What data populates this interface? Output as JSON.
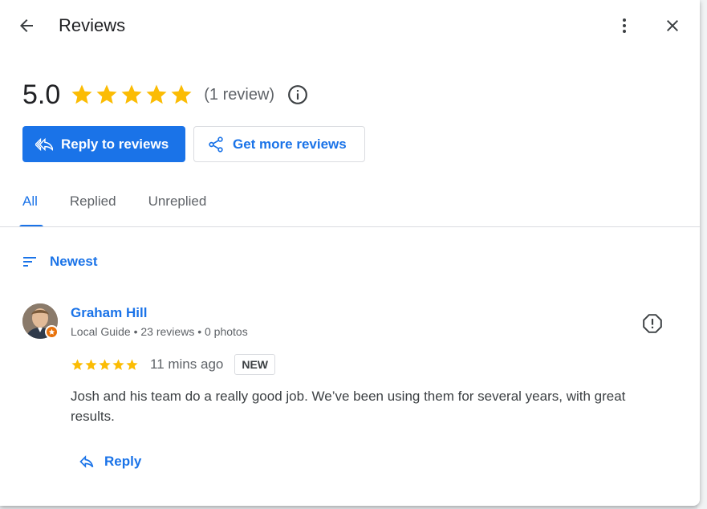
{
  "header": {
    "title": "Reviews",
    "back_icon": "arrow-back-icon",
    "more_icon": "more-vert-icon",
    "close_icon": "close-icon"
  },
  "summary": {
    "rating": "5.0",
    "stars": 5,
    "review_count": "(1 review)",
    "info_icon": "info-icon"
  },
  "actions": {
    "reply_to_reviews": "Reply to reviews",
    "get_more_reviews": "Get more reviews"
  },
  "tabs": [
    {
      "label": "All",
      "active": true
    },
    {
      "label": "Replied",
      "active": false
    },
    {
      "label": "Unreplied",
      "active": false
    }
  ],
  "sort": {
    "label": "Newest"
  },
  "review": {
    "reviewer_name": "Graham Hill",
    "reviewer_meta": "Local Guide • 23 reviews • 0 photos",
    "stars": 5,
    "time": "11 mins ago",
    "badge": "NEW",
    "text": "Josh and his team do a really good job. We’ve been using them for several years, with great results.",
    "reply_label": "Reply"
  },
  "colors": {
    "accent": "#1a73e8",
    "star": "#fbbc04",
    "text_primary": "#202124",
    "text_secondary": "#5f6368"
  }
}
